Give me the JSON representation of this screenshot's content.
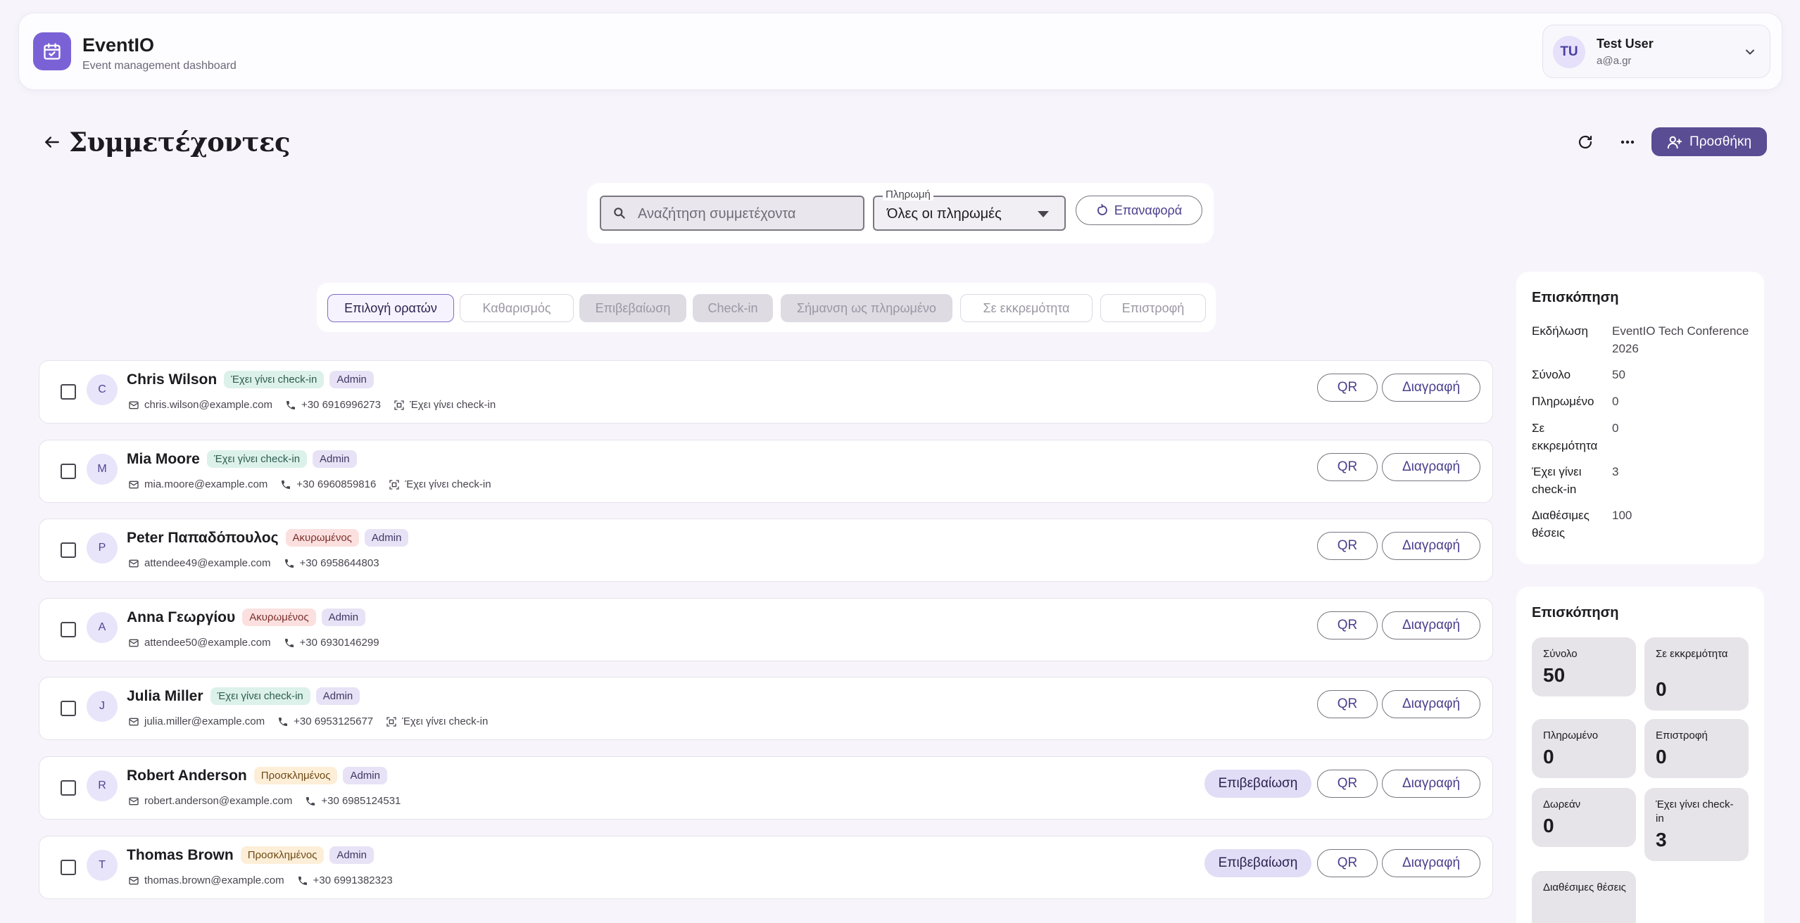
{
  "app": {
    "name": "EventIO",
    "subtitle": "Event management dashboard"
  },
  "user": {
    "initials": "TU",
    "name": "Test User",
    "email": "a@a.gr"
  },
  "page": {
    "title": "Συμμετέχοντες",
    "add_label": "Προσθήκη"
  },
  "search": {
    "placeholder": "Αναζήτηση συμμετέχοντα",
    "value": ""
  },
  "payment_filter": {
    "label": "Πληρωμή",
    "value": "Όλες οι πληρωμές"
  },
  "reset_label": "Επαναφορά",
  "toolbar": {
    "select_visible": "Επιλογή ορατών",
    "clear": "Καθαρισμός",
    "confirm": "Επιβεβαίωση",
    "checkin": "Check-in",
    "mark_paid": "Σήμανση ως πληρωμένο",
    "pending": "Σε εκκρεμότητα",
    "refund": "Επιστροφή"
  },
  "row_actions": {
    "confirm": "Επιβεβαίωση",
    "qr": "QR",
    "delete": "Διαγραφή"
  },
  "attendees": [
    {
      "initial": "C",
      "name": "Chris Wilson",
      "status": "Έχει γίνει check-in",
      "status_kind": "checkin",
      "role": "Admin",
      "email": "chris.wilson@example.com",
      "phone": "+30 6916996273",
      "checkin_note": "Έχει γίνει check-in",
      "show_confirm": false
    },
    {
      "initial": "M",
      "name": "Mia Moore",
      "status": "Έχει γίνει check-in",
      "status_kind": "checkin",
      "role": "Admin",
      "email": "mia.moore@example.com",
      "phone": "+30 6960859816",
      "checkin_note": "Έχει γίνει check-in",
      "show_confirm": false
    },
    {
      "initial": "P",
      "name": "Peter Παπαδόπουλος",
      "status": "Ακυρωμένος",
      "status_kind": "cancel",
      "role": "Admin",
      "email": "attendee49@example.com",
      "phone": "+30 6958644803",
      "checkin_note": "",
      "show_confirm": false
    },
    {
      "initial": "A",
      "name": "Anna Γεωργίου",
      "status": "Ακυρωμένος",
      "status_kind": "cancel",
      "role": "Admin",
      "email": "attendee50@example.com",
      "phone": "+30 6930146299",
      "checkin_note": "",
      "show_confirm": false
    },
    {
      "initial": "J",
      "name": "Julia Miller",
      "status": "Έχει γίνει check-in",
      "status_kind": "checkin",
      "role": "Admin",
      "email": "julia.miller@example.com",
      "phone": "+30 6953125677",
      "checkin_note": "Έχει γίνει check-in",
      "show_confirm": false
    },
    {
      "initial": "R",
      "name": "Robert Anderson",
      "status": "Προσκλημένος",
      "status_kind": "invited",
      "role": "Admin",
      "email": "robert.anderson@example.com",
      "phone": "+30 6985124531",
      "checkin_note": "",
      "show_confirm": true
    },
    {
      "initial": "T",
      "name": "Thomas Brown",
      "status": "Προσκλημένος",
      "status_kind": "invited",
      "role": "Admin",
      "email": "thomas.brown@example.com",
      "phone": "+30 6991382323",
      "checkin_note": "",
      "show_confirm": true
    }
  ],
  "overview": {
    "title": "Επισκόπηση",
    "rows": [
      {
        "label": "Εκδήλωση",
        "value": "EventIO Tech Conference 2026"
      },
      {
        "label": "Σύνολο",
        "value": "50"
      },
      {
        "label": "Πληρωμένο",
        "value": "0"
      },
      {
        "label": "Σε εκκρεμότητα",
        "value": "0"
      },
      {
        "label": "Έχει γίνει check-in",
        "value": "3"
      },
      {
        "label": "Διαθέσιμες θέσεις",
        "value": "100"
      }
    ]
  },
  "stats": {
    "title": "Επισκόπηση",
    "tiles": [
      {
        "label": "Σύνολο",
        "value": "50"
      },
      {
        "label": "Σε εκκρεμότητα",
        "value": "0"
      },
      {
        "label": "Πληρωμένο",
        "value": "0"
      },
      {
        "label": "Επιστροφή",
        "value": "0"
      },
      {
        "label": "Δωρεάν",
        "value": "0"
      },
      {
        "label": "Έχει γίνει check-in",
        "value": "3"
      },
      {
        "label": "Διαθέσιμες θέσεις",
        "value": ""
      }
    ]
  },
  "colors": {
    "accent": "#5a4d93",
    "brand": "#7a62d6",
    "background": "#f7f5fb"
  }
}
